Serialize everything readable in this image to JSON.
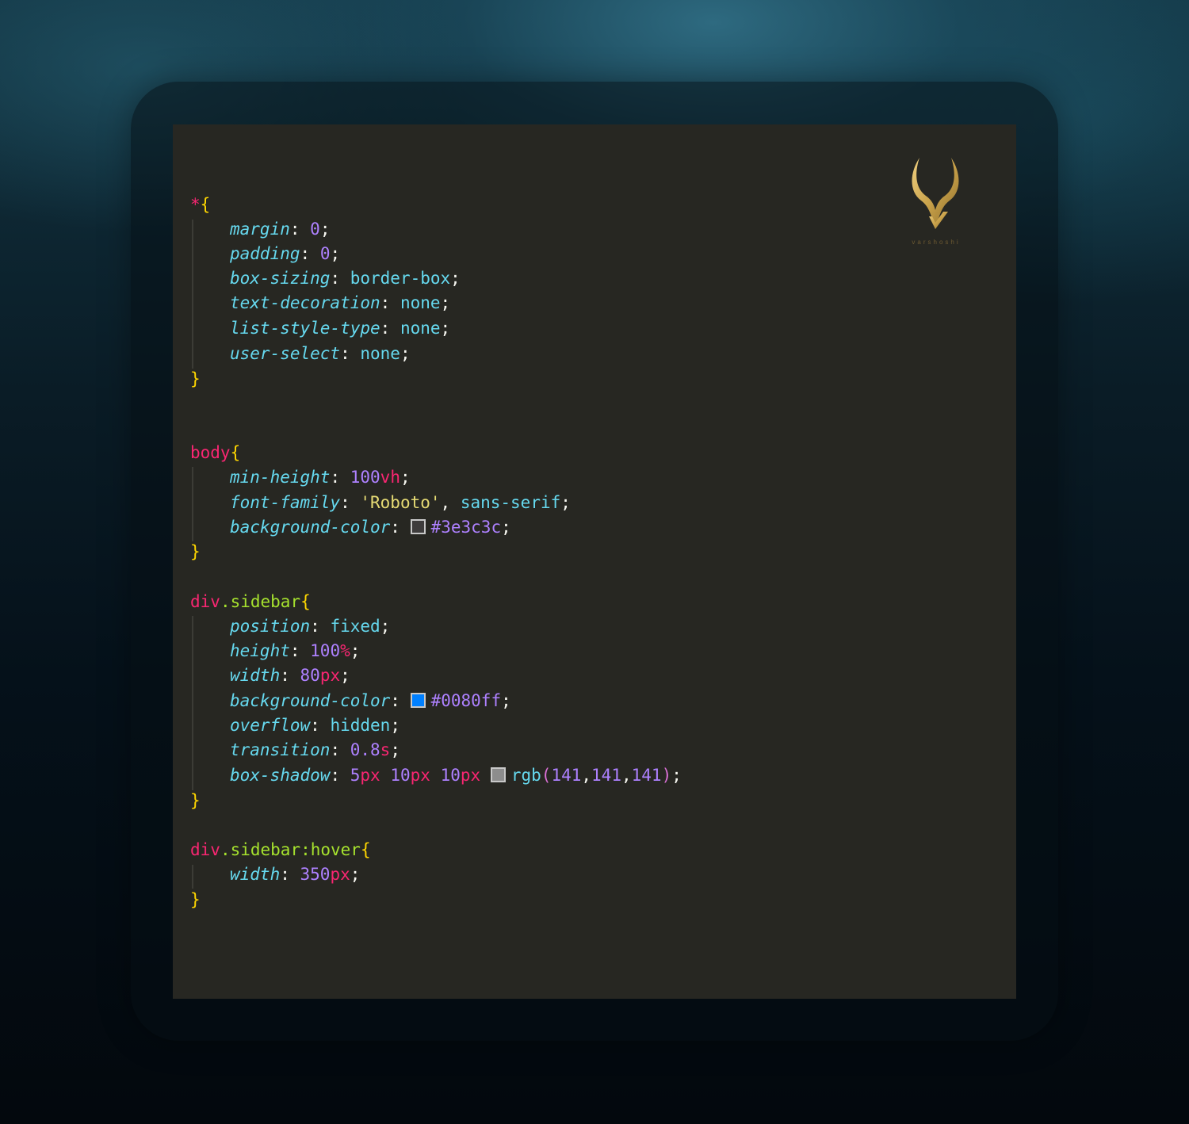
{
  "logo": {
    "text": "varshoshi",
    "color": "#c9a24a"
  },
  "colors": {
    "selector": "#f92672",
    "class": "#a6e22e",
    "brace": "#ffd700",
    "property": "#66d9ef",
    "value_keyword": "#66d9ef",
    "number": "#ae81ff",
    "unit": "#f92672",
    "string": "#e6db74",
    "editor_bg": "#272722"
  },
  "code": {
    "rule1": {
      "selector": "*",
      "decls": [
        {
          "prop": "margin",
          "val": "0"
        },
        {
          "prop": "padding",
          "val": "0"
        },
        {
          "prop": "box-sizing",
          "val": "border-box"
        },
        {
          "prop": "text-decoration",
          "val": "none"
        },
        {
          "prop": "list-style-type",
          "val": "none"
        },
        {
          "prop": "user-select",
          "val": "none"
        }
      ]
    },
    "rule2": {
      "selector": "body",
      "decls": [
        {
          "prop": "min-height",
          "num": "100",
          "unit": "vh"
        },
        {
          "prop": "font-family",
          "str": "'Roboto'",
          "val": "sans-serif"
        },
        {
          "prop": "background-color",
          "swatch": "#3e3c3c",
          "val": "#3e3c3c"
        }
      ]
    },
    "rule3": {
      "tag": "div",
      "cls": ".sidebar",
      "decls": [
        {
          "prop": "position",
          "val": "fixed"
        },
        {
          "prop": "height",
          "num": "100",
          "unit": "%"
        },
        {
          "prop": "width",
          "num": "80",
          "unit": "px"
        },
        {
          "prop": "background-color",
          "swatch": "#0080ff",
          "val": "#0080ff"
        },
        {
          "prop": "overflow",
          "val": "hidden"
        },
        {
          "prop": "transition",
          "num": "0.8",
          "unit": "s"
        },
        {
          "prop": "box-shadow",
          "v1": "5",
          "u1": "px",
          "v2": "10",
          "u2": "px",
          "v3": "10",
          "u3": "px",
          "swatch": "rgb(141,141,141)",
          "fn": "rgb",
          "a": "141",
          "b": "141",
          "c": "141"
        }
      ]
    },
    "rule4": {
      "tag": "div",
      "cls": ".sidebar:hover",
      "decls": [
        {
          "prop": "width",
          "num": "350",
          "unit": "px"
        }
      ]
    },
    "open_brace": "{",
    "close_brace": "}",
    "colon": ": ",
    "semi": ";",
    "comma": ", ",
    "comma_tight": ",",
    "lparen": "(",
    "rparen": ")"
  }
}
